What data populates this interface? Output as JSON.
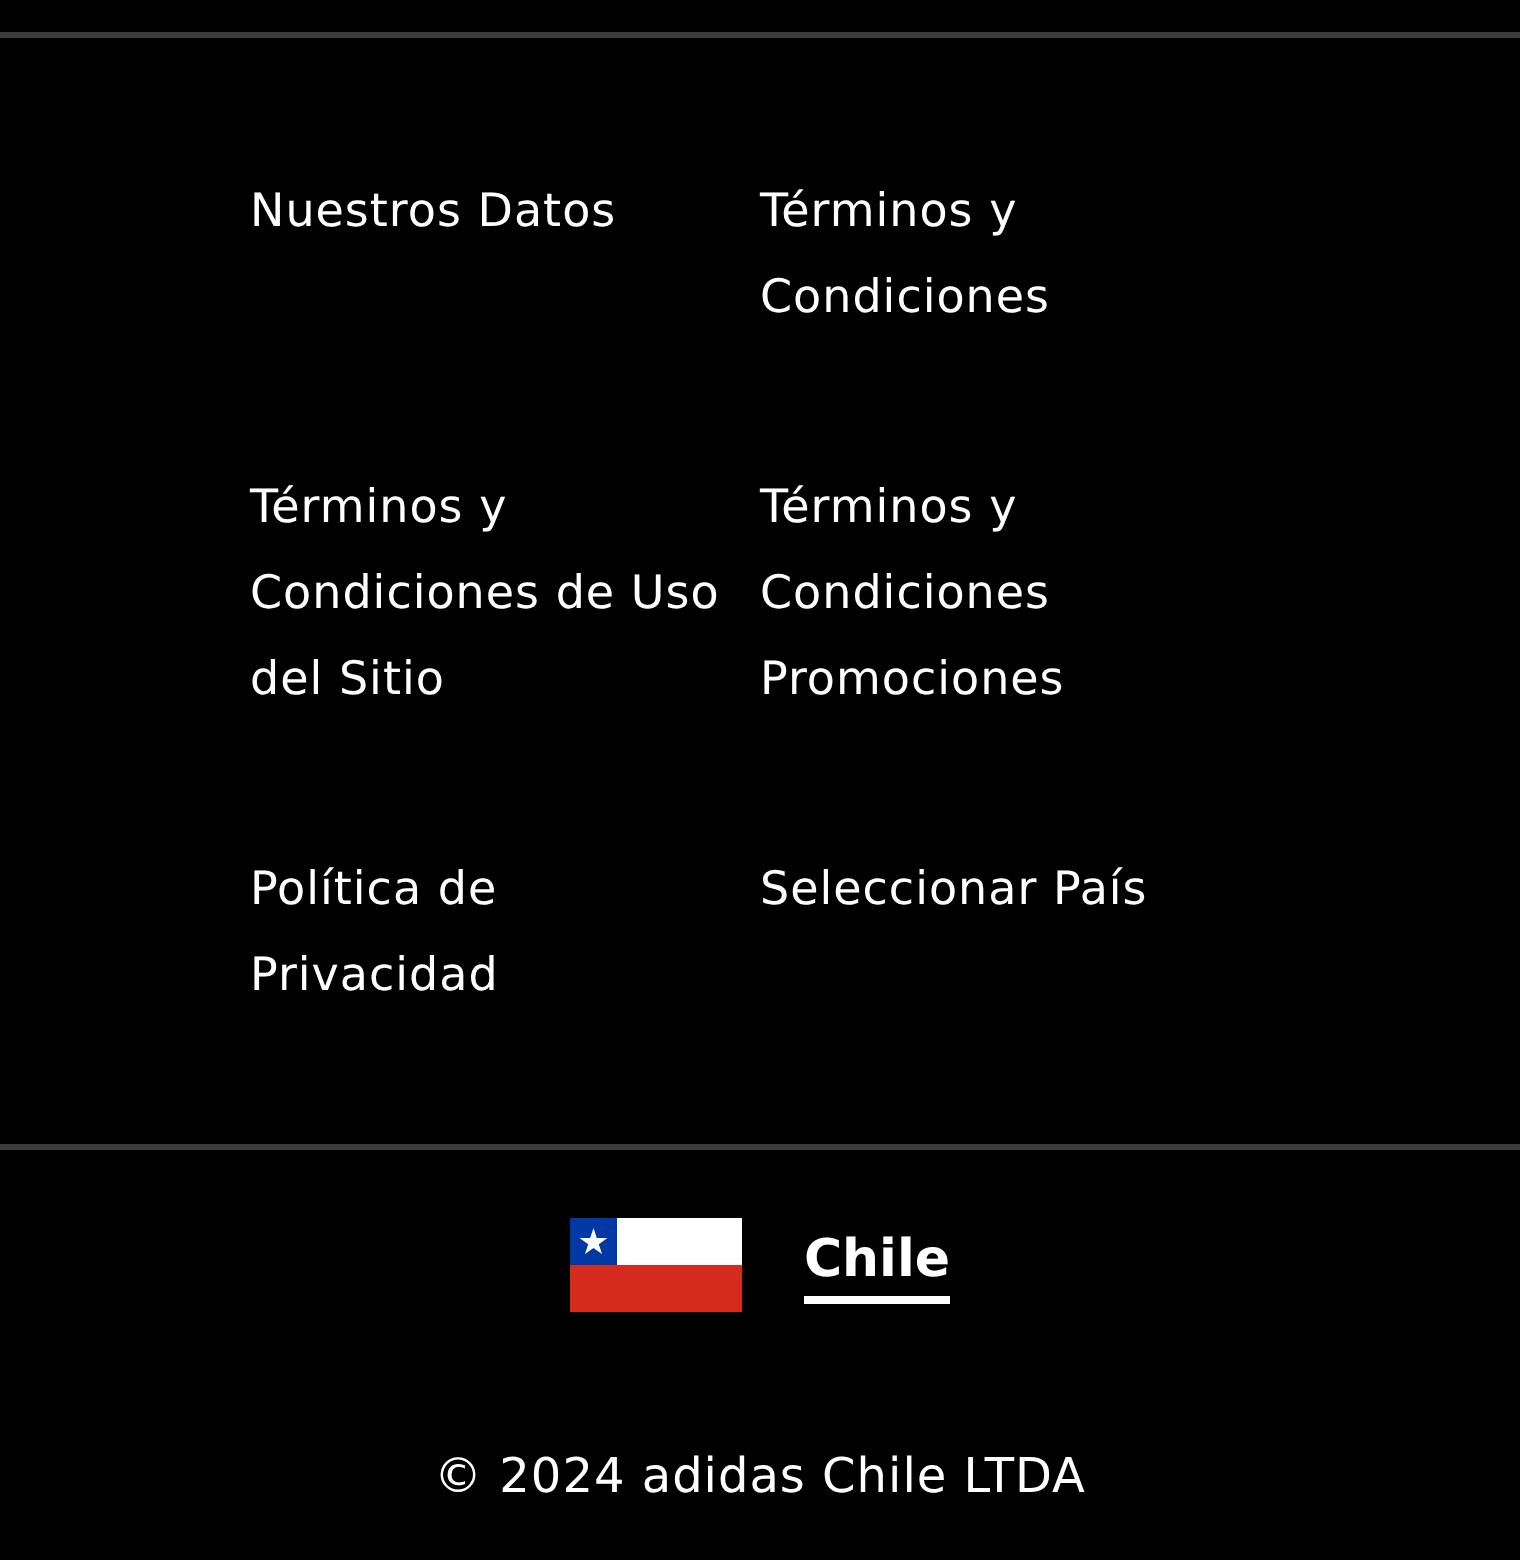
{
  "footer_links": [
    {
      "label": "Nuestros Datos"
    },
    {
      "label": "Términos y Condiciones"
    },
    {
      "label": "Términos y Condiciones de Uso del Sitio"
    },
    {
      "label": "Términos y Condiciones Promociones"
    },
    {
      "label": "Política de Privacidad"
    },
    {
      "label": "Seleccionar País"
    }
  ],
  "country": {
    "name": "Chile"
  },
  "copyright": "© 2024 adidas Chile LTDA"
}
